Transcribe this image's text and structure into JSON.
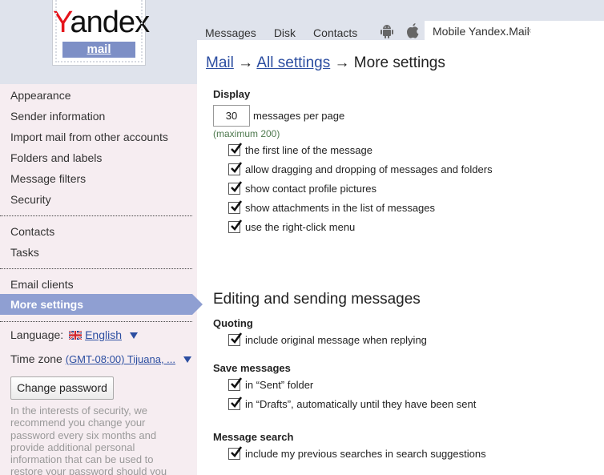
{
  "logo": {
    "word": "Yandex",
    "first_letter": "Y",
    "rest": "andex",
    "sub": "mail"
  },
  "topnav": {
    "items": [
      "Messages",
      "Disk",
      "Contacts"
    ],
    "icons": [
      "android-icon",
      "apple-icon"
    ],
    "mobile_tab": {
      "label": "Mobile Yandex.Mail",
      "close": "×"
    }
  },
  "breadcrumb": {
    "mail": "Mail",
    "arrow1": "→",
    "all_settings": "All settings",
    "arrow2": "→",
    "current": "More settings"
  },
  "sidebar": {
    "group1": [
      "Appearance",
      "Sender information",
      "Import mail from other accounts",
      "Folders and labels",
      "Message filters",
      "Security"
    ],
    "group2": [
      "Contacts",
      "Tasks"
    ],
    "group3": [
      "Email clients",
      "More settings"
    ],
    "active": "More settings",
    "language_label": "Language:",
    "language_value": "English",
    "timezone_label": "Time zone",
    "timezone_value": "(GMT-08:00) Tijuana, ...",
    "change_password": "Change password",
    "note": "In the interests of security, we recommend you change your password every six months and provide additional personal information that can be used to restore your password should you"
  },
  "display": {
    "heading": "Display",
    "per_page_value": "30",
    "per_page_label": "messages per page",
    "max_hint": "(maximum 200)",
    "options": [
      {
        "label": "the first line of the message",
        "checked": true
      },
      {
        "label": "allow dragging and dropping of messages and folders",
        "checked": true
      },
      {
        "label": "show contact profile pictures",
        "checked": true
      },
      {
        "label": "show attachments in the list of messages",
        "checked": true
      },
      {
        "label": "use the right-click menu",
        "checked": true
      }
    ]
  },
  "editing": {
    "heading": "Editing and sending messages",
    "quoting": {
      "heading": "Quoting",
      "options": [
        {
          "label": "include original message when replying",
          "checked": true
        }
      ]
    },
    "save": {
      "heading": "Save messages",
      "options": [
        {
          "label": "in “Sent” folder",
          "checked": true
        },
        {
          "label": "in “Drafts”, automatically until they have been sent",
          "checked": true
        }
      ]
    },
    "search": {
      "heading": "Message search",
      "options": [
        {
          "label": "include my previous searches in search suggestions",
          "checked": true
        }
      ]
    }
  },
  "colors": {
    "accent": "#8f9fd2",
    "link": "#2c4ea1",
    "header_bg": "#dfe3ec",
    "sidebar_bg": "#f6edf1",
    "logo_red": "#e5141b"
  }
}
